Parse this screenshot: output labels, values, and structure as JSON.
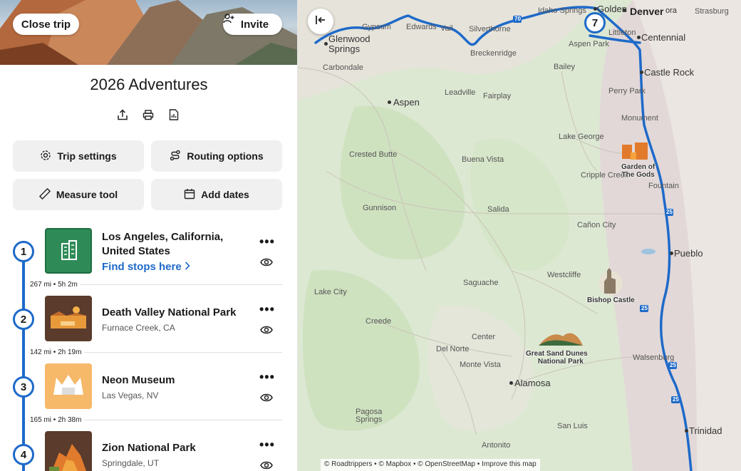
{
  "header": {
    "close_label": "Close trip",
    "invite_label": "Invite",
    "trip_title": "2026 Adventures"
  },
  "toolbar": {
    "icons": [
      "share-icon",
      "print-icon",
      "report-icon"
    ]
  },
  "actions": {
    "trip_settings": "Trip settings",
    "routing_options": "Routing options",
    "measure_tool": "Measure tool",
    "add_dates": "Add dates"
  },
  "stops": [
    {
      "number": "1",
      "title_line1": "Los Angeles, California,",
      "title_line2": "United States",
      "link": "Find stops here"
    },
    {
      "number": "2",
      "title": "Death Valley National Park",
      "subtitle": "Furnace Creek, CA"
    },
    {
      "number": "3",
      "title": "Neon Museum",
      "subtitle": "Las Vegas, NV"
    },
    {
      "number": "4",
      "title": "Zion National Park",
      "subtitle": "Springdale, UT"
    }
  ],
  "legs": [
    "267 mi • 5h 2m",
    "142 mi • 2h 19m",
    "165 mi • 2h 38m"
  ],
  "map": {
    "marker_number": "7",
    "route_color": "#1e6ac9",
    "cities": {
      "golden": "Golden",
      "denver": "Denver",
      "centennial": "Centennial",
      "castle_rock": "Castle Rock",
      "glenwood_1": "Glenwood",
      "glenwood_2": "Springs",
      "aspen": "Aspen",
      "pueblo": "Pueblo",
      "alamosa": "Alamosa",
      "trinidad": "Trinidad",
      "aurora_fragment": "ora"
    },
    "towns": {
      "gypsum": "Gypsum",
      "edwards": "Edwards",
      "vail": "Vail",
      "silverthorne": "Silverthorne",
      "idaho_springs": "Idaho Springs",
      "strasburg": "Strasburg",
      "littleton": "Littleton",
      "aspen_park": "Aspen Park",
      "breckenridge": "Breckenridge",
      "bailey": "Bailey",
      "carbondale": "Carbondale",
      "leadville": "Leadville",
      "fairplay": "Fairplay",
      "perry_park": "Perry Park",
      "monument": "Monument",
      "lake_george": "Lake George",
      "crested_butte": "Crested Butte",
      "buena_vista": "Buena Vista",
      "cripple_creek": "Cripple Creek",
      "fountain": "Fountain",
      "gunnison": "Gunnison",
      "salida": "Salida",
      "canon_city": "Cañon City",
      "westcliffe": "Westcliffe",
      "lake_city": "Lake City",
      "saguache": "Saguache",
      "creede": "Creede",
      "center": "Center",
      "del_norte": "Del Norte",
      "monte_vista": "Monte Vista",
      "walsenburg": "Walsenburg",
      "pagosa_1": "Pagosa",
      "pagosa_2": "Springs",
      "san_luis": "San Luis",
      "antonito": "Antonito"
    },
    "pois": {
      "garden_1": "Garden of",
      "garden_2": "The Gods",
      "bishop": "Bishop Castle",
      "dunes_1": "Great Sand Dunes",
      "dunes_2": "National Park"
    },
    "highway_shields": [
      "70",
      "25",
      "25",
      "25",
      "25"
    ],
    "attribution": "© Roadtrippers • © Mapbox • © OpenStreetMap • Improve this map"
  }
}
